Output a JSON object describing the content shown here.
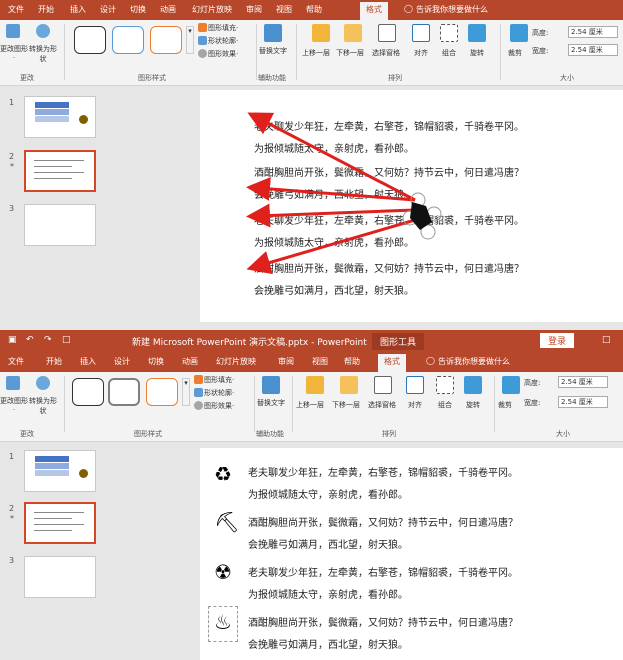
{
  "top": {
    "tabs": [
      "文件",
      "开始",
      "插入",
      "设计",
      "切换",
      "动画",
      "幻灯片放映",
      "审阅",
      "视图",
      "帮助",
      "格式"
    ],
    "active_tab": "格式",
    "tell_me": "告诉我你想要做什么",
    "ribbon": {
      "change_shape": "更改图形·",
      "convert": "转换为形状",
      "group_change": "更改",
      "fill": "图形填充·",
      "outline": "形状轮廓·",
      "effect": "图形效果·",
      "group_styles": "图形样式",
      "alt_text": "替换文字",
      "group_access": "辅助功能",
      "bring_forward": "上移一层",
      "send_backward": "下移一层",
      "selection_pane": "选择窗格",
      "align": "对齐",
      "group": "组合",
      "rotate": "旋转",
      "group_arrange": "排列",
      "crop": "裁剪",
      "height_label": "高度:",
      "height_value": "2.54 厘米",
      "width_label": "宽度:",
      "width_value": "2.54 厘米",
      "group_size": "大小"
    },
    "slides": [
      "1",
      "2",
      "3"
    ]
  },
  "bottom": {
    "title": "新建 Microsoft PowerPoint 演示文稿.pptx - PowerPoint",
    "tool_context": "图形工具",
    "login": "登录",
    "tabs": [
      "文件",
      "开始",
      "插入",
      "设计",
      "切换",
      "动画",
      "幻灯片放映",
      "审阅",
      "视图",
      "帮助",
      "格式"
    ],
    "active_tab": "格式",
    "tell_me": "告诉我你想要做什么",
    "ribbon": {
      "change_shape": "更改图形·",
      "convert": "转换为形状",
      "group_change": "更改",
      "fill": "图形填充·",
      "outline": "形状轮廓·",
      "effect": "图形效果·",
      "group_styles": "图形样式",
      "alt_text": "替换文字",
      "group_access": "辅助功能",
      "bring_forward": "上移一层",
      "send_backward": "下移一层",
      "selection_pane": "选择窗格",
      "align": "对齐",
      "group": "组合",
      "rotate": "旋转",
      "group_arrange": "排列",
      "crop": "裁剪",
      "height_label": "高度:",
      "height_value": "2.54 厘米",
      "width_label": "宽度:",
      "width_value": "2.54 厘米",
      "group_size": "大小"
    },
    "slides": [
      "1",
      "2",
      "3"
    ]
  },
  "poem": {
    "l1": "老夫聊发少年狂，左牵黄，右擎苍，锦帽貂裘，千骑卷平冈。",
    "l2": "为报倾城随太守，亲射虎，看孙郎。",
    "l3": "酒酣胸胆尚开张，鬓微霜，又何妨？持节云中，何日遣冯唐？",
    "l4": "会挽雕弓如满月，西北望，射天狼。"
  },
  "colors": {
    "accent": "#b7472a",
    "select": "#d24726",
    "arrow": "#e0201d"
  },
  "icons": [
    "recycle-icon",
    "person-icon",
    "radiation-icon",
    "fire-icon"
  ]
}
